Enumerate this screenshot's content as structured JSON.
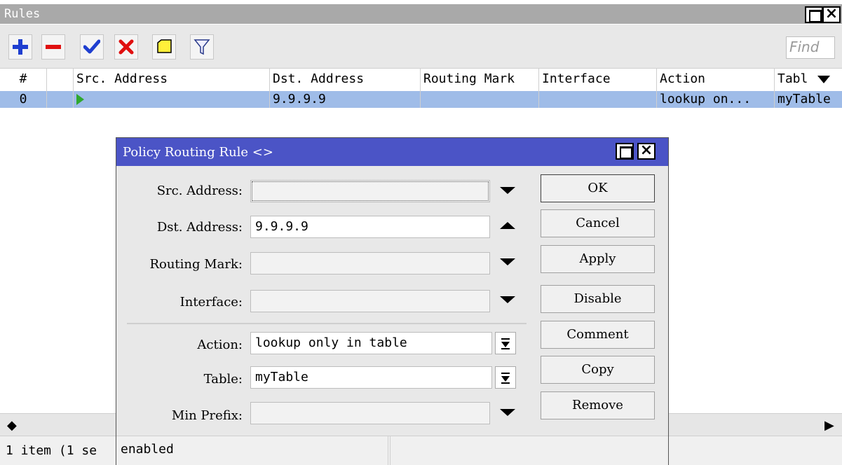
{
  "window": {
    "title": "Rules"
  },
  "toolbar": {
    "find_placeholder": "Find",
    "buttons": [
      {
        "name": "add-button",
        "icon": "plus-icon"
      },
      {
        "name": "remove-button",
        "icon": "minus-icon"
      },
      {
        "name": "enable-button",
        "icon": "check-icon"
      },
      {
        "name": "disable-button",
        "icon": "x-icon"
      },
      {
        "name": "comment-button",
        "icon": "note-icon"
      },
      {
        "name": "filter-button",
        "icon": "funnel-icon"
      }
    ]
  },
  "table": {
    "columns": [
      "#",
      "",
      "Src. Address",
      "Dst. Address",
      "Routing Mark",
      "Interface",
      "Action",
      "Tabl"
    ],
    "rows": [
      {
        "index": "0",
        "src_address": "",
        "dst_address": "9.9.9.9",
        "routing_mark": "",
        "interface": "",
        "action": "lookup on...",
        "table": "myTable"
      }
    ]
  },
  "status": {
    "text": "1 item (1 se"
  },
  "dialog": {
    "title": "Policy Routing Rule <>",
    "fields": {
      "src_address": {
        "label": "Src. Address:",
        "value": ""
      },
      "dst_address": {
        "label": "Dst. Address:",
        "value": "9.9.9.9"
      },
      "routing_mark": {
        "label": "Routing Mark:",
        "value": ""
      },
      "interface": {
        "label": "Interface:",
        "value": ""
      },
      "action": {
        "label": "Action:",
        "value": "lookup only in table"
      },
      "table": {
        "label": "Table:",
        "value": "myTable"
      },
      "min_prefix": {
        "label": "Min Prefix:",
        "value": ""
      }
    },
    "buttons": {
      "ok": "OK",
      "cancel": "Cancel",
      "apply": "Apply",
      "disable": "Disable",
      "comment": "Comment",
      "copy": "Copy",
      "remove": "Remove"
    },
    "status": "enabled"
  },
  "colors": {
    "dialog_title_bg": "#4b54c6",
    "window_title_bg": "#a9a9a9",
    "selected_row_bg": "#9fbce8",
    "plus_icon": "#1f3fd0",
    "minus_icon": "#e01010",
    "check_icon": "#1f3fd0",
    "x_icon": "#e01010",
    "note_icon": "#ffef3a",
    "enabled_arrow": "#2fa82f"
  }
}
